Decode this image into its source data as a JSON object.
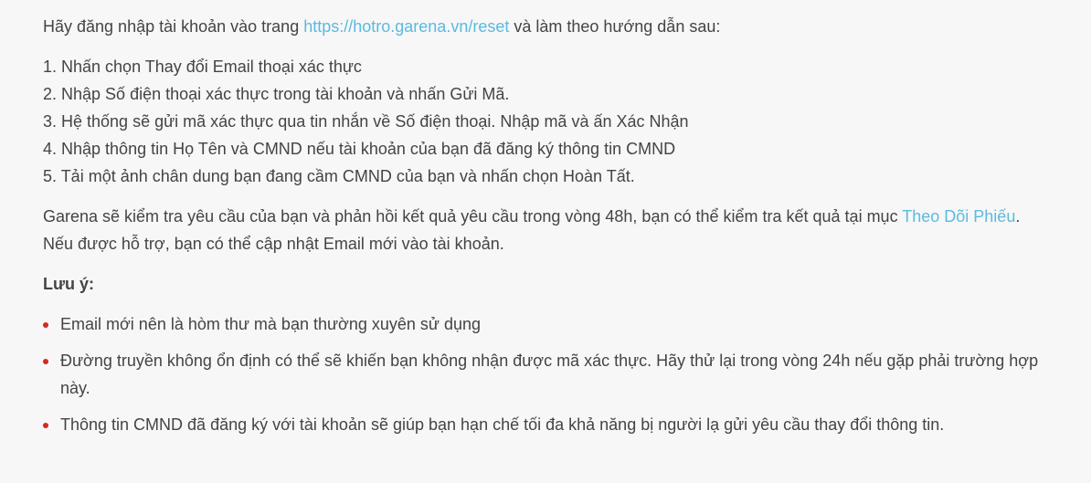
{
  "intro": {
    "before": "Hãy đăng nhập tài khoản vào trang ",
    "link": "https://hotro.garena.vn/reset",
    "after": " và làm theo hướng dẫn sau:"
  },
  "steps": [
    "1. Nhấn chọn Thay đổi Email thoại xác thực",
    "2. Nhập Số điện thoại xác thực trong tài khoản và nhấn Gửi Mã.",
    "3. Hệ thống sẽ gửi mã xác thực qua tin nhắn về Số điện thoại. Nhập mã và ấn Xác Nhận",
    "4. Nhập thông tin Họ Tên và CMND nếu tài khoản của bạn đã đăng ký thông tin CMND",
    "5. Tải một ảnh chân dung bạn đang cầm CMND của bạn và nhấn chọn Hoàn Tất."
  ],
  "result": {
    "before": "Garena sẽ kiểm tra yêu cầu của bạn và phản hồi kết quả yêu cầu trong vòng 48h, bạn có thể kiểm tra kết quả tại mục ",
    "link": "Theo Dõi Phiếu",
    "after": ". Nếu được hỗ trợ, bạn có thể cập nhật Email mới vào tài khoản."
  },
  "note_title": "Lưu ý:",
  "notes": [
    "Email mới nên là hòm thư mà bạn thường xuyên sử dụng",
    "Đường truyền không ổn định có thể sẽ khiến bạn không nhận được mã xác thực. Hãy thử lại trong vòng 24h nếu gặp phải trường hợp này.",
    "Thông tin CMND đã đăng ký với tài khoản sẽ giúp bạn hạn chế tối đa khả năng bị người lạ gửi yêu cầu thay đổi thông tin."
  ],
  "colors": {
    "link": "#5bbadf",
    "bullet": "#d6281e",
    "text": "#444444",
    "background": "#f7f7f7"
  }
}
